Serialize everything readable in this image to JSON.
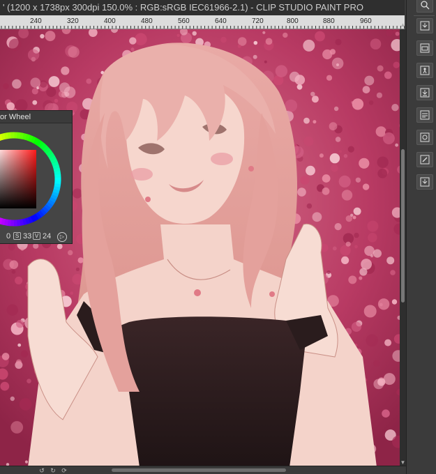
{
  "window": {
    "title": "' (1200 x 1738px 300dpi 150.0% : RGB:sRGB IEC61966-2.1)  - CLIP STUDIO PAINT PRO"
  },
  "ruler": {
    "labels": [
      "240",
      "320",
      "400",
      "480",
      "560",
      "640",
      "720",
      "800",
      "880",
      "960"
    ]
  },
  "color_wheel": {
    "title": "or Wheel",
    "h_value": "0",
    "s_label": "S",
    "s_value": "33",
    "v_label": "V",
    "v_value": "24",
    "current_color": "#c8282a"
  },
  "canvas": {
    "description_free": true
  },
  "right_panel": {
    "icons": [
      "navigator-icon",
      "import-icon",
      "folder-icon",
      "person-export-icon",
      "download-icon",
      "document-icon",
      "camera-icon",
      "edit-icon",
      "download-alt-icon"
    ]
  },
  "colors": {
    "accent_bg": "#b0325c",
    "hair": "#e7a7a3",
    "dress": "#2b1d1f",
    "skin": "#f6d8d0"
  }
}
